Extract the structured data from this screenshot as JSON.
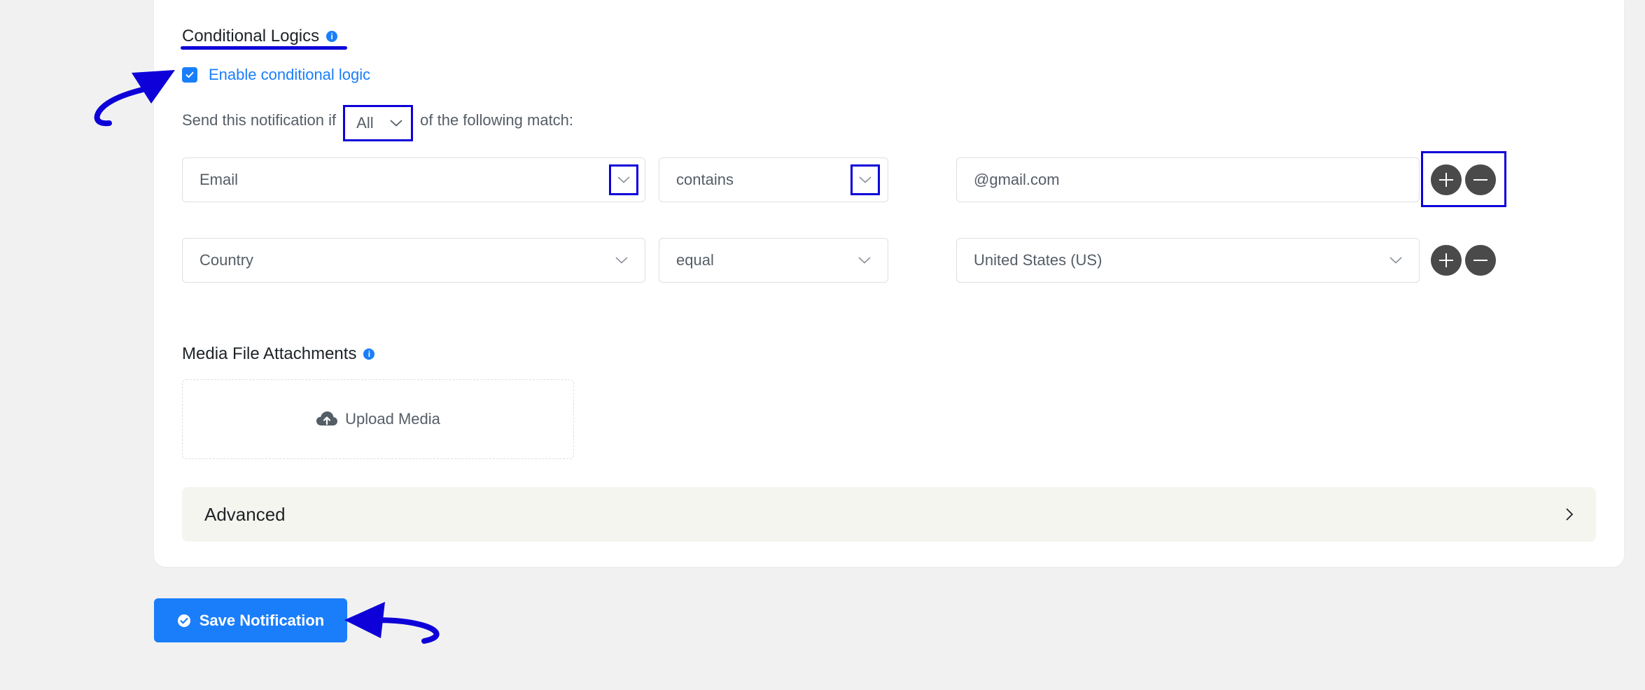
{
  "conditional": {
    "title": "Conditional Logics",
    "info_icon": "info-icon",
    "enable_label": "Enable conditional logic",
    "enabled": true,
    "send_prefix": "Send this notification if",
    "match_value": "All",
    "send_suffix": "of the following match:"
  },
  "rules": [
    {
      "field": "Email",
      "operator": "contains",
      "value": "@gmail.com"
    },
    {
      "field": "Country",
      "operator": "equal",
      "value": "United States (US)"
    }
  ],
  "media": {
    "title": "Media File Attachments",
    "upload_label": "Upload Media",
    "upload_icon": "cloud-upload-icon"
  },
  "advanced": {
    "label": "Advanced",
    "icon": "chevron-right-icon"
  },
  "save": {
    "label": "Save Notification",
    "icon": "check-circle-icon"
  },
  "colors": {
    "accent": "#1a7efb",
    "annotation": "#0d00d8",
    "circle_button": "#4a4a4a"
  }
}
